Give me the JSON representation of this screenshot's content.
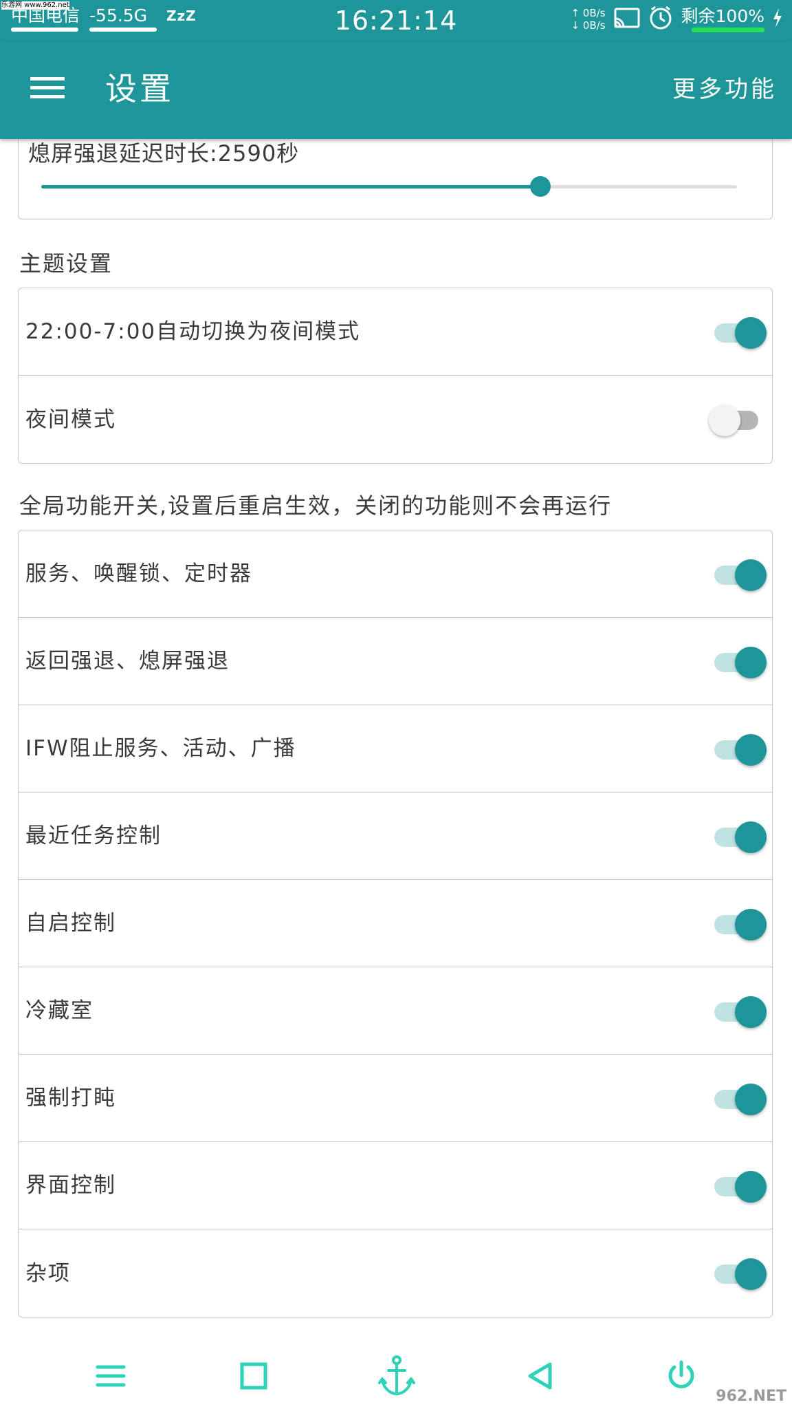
{
  "status_bar": {
    "carrier": "中国电信",
    "signal": "-55.5G",
    "sleep": "ZzZ",
    "time": "16:21:14",
    "net_up": "↑ 0B/s",
    "net_down": "↓ 0B/s",
    "battery": "剩余100%",
    "battery_level": 1.0
  },
  "app_bar": {
    "title": "设置",
    "action": "更多功能"
  },
  "slider": {
    "label": "熄屏强退延迟时长:2590秒",
    "fraction": 0.717
  },
  "sections": [
    {
      "header": "主题设置",
      "rows": [
        {
          "label": "22:00-7:00自动切换为夜间模式",
          "on": true
        },
        {
          "label": "夜间模式",
          "on": false
        }
      ]
    },
    {
      "header": "全局功能开关,设置后重启生效，关闭的功能则不会再运行",
      "rows": [
        {
          "label": "服务、唤醒锁、定时器",
          "on": true
        },
        {
          "label": "返回强退、熄屏强退",
          "on": true
        },
        {
          "label": "IFW阻止服务、活动、广播",
          "on": true
        },
        {
          "label": "最近任务控制",
          "on": true
        },
        {
          "label": "自启控制",
          "on": true
        },
        {
          "label": "冷藏室",
          "on": true
        },
        {
          "label": "强制打盹",
          "on": true
        },
        {
          "label": "界面控制",
          "on": true
        },
        {
          "label": "杂项",
          "on": true
        }
      ]
    }
  ],
  "nav_bar": {
    "icons": [
      "menu-icon",
      "square-icon",
      "anchor-icon",
      "back-triangle-icon",
      "power-icon"
    ],
    "accent": "#2fd2b9"
  },
  "watermark": "962.NET",
  "watermark_top": "乐游网 www.962.net",
  "colors": {
    "primary": "#1e9699",
    "switch_track_on": "#bfe2e2"
  }
}
